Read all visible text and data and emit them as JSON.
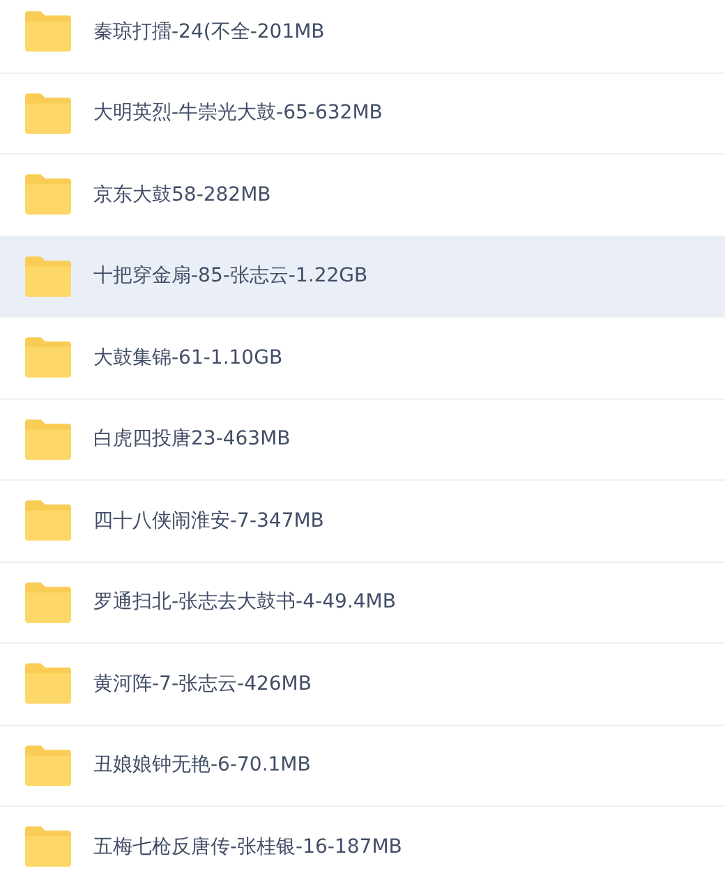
{
  "files": [
    {
      "name": "秦琼打擂-24(不全-201MB",
      "selected": false
    },
    {
      "name": "大明英烈-牛崇光大鼓-65-632MB",
      "selected": false
    },
    {
      "name": "京东大鼓58-282MB",
      "selected": false
    },
    {
      "name": "十把穿金扇-85-张志云-1.22GB",
      "selected": true
    },
    {
      "name": "大鼓集锦-61-1.10GB",
      "selected": false
    },
    {
      "name": "白虎四投唐23-463MB",
      "selected": false
    },
    {
      "name": "四十八侠闹淮安-7-347MB",
      "selected": false
    },
    {
      "name": "罗通扫北-张志去大鼓书-4-49.4MB",
      "selected": false
    },
    {
      "name": "黄河阵-7-张志云-426MB",
      "selected": false
    },
    {
      "name": "丑娘娘钟无艳-6-70.1MB",
      "selected": false
    },
    {
      "name": "五梅七枪反唐传-张桂银-16-187MB",
      "selected": false
    }
  ]
}
